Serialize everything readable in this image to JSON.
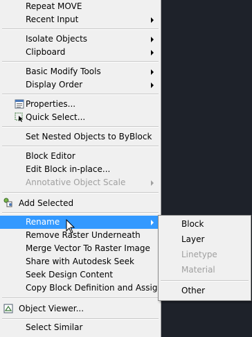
{
  "menu": {
    "items": [
      {
        "label": "Repeat MOVE"
      },
      {
        "label": "Recent Input"
      },
      {
        "label": "Isolate Objects"
      },
      {
        "label": "Clipboard"
      },
      {
        "label": "Basic Modify Tools"
      },
      {
        "label": "Display Order"
      },
      {
        "label": "Properties..."
      },
      {
        "label": "Quick Select..."
      },
      {
        "label": "Set Nested Objects to ByBlock"
      },
      {
        "label": "Block Editor"
      },
      {
        "label": "Edit Block in-place..."
      },
      {
        "label": "Annotative Object Scale"
      },
      {
        "label": "Add Selected"
      },
      {
        "label": "Rename"
      },
      {
        "label": "Remove Raster Underneath"
      },
      {
        "label": "Merge Vector To Raster Image"
      },
      {
        "label": "Share with Autodesk Seek"
      },
      {
        "label": "Seek Design Content"
      },
      {
        "label": "Copy Block Definition and Assign..."
      },
      {
        "label": "Object Viewer..."
      },
      {
        "label": "Select Similar"
      }
    ]
  },
  "submenu": {
    "items": [
      {
        "label": "Block"
      },
      {
        "label": "Layer"
      },
      {
        "label": "Linetype"
      },
      {
        "label": "Material"
      },
      {
        "label": "Other"
      }
    ]
  },
  "colors": {
    "menu_bg": "#f0f0f0",
    "highlight": "#3399ff",
    "disabled_text": "#a0a0a0",
    "canvas_bg": "#1e222a"
  }
}
